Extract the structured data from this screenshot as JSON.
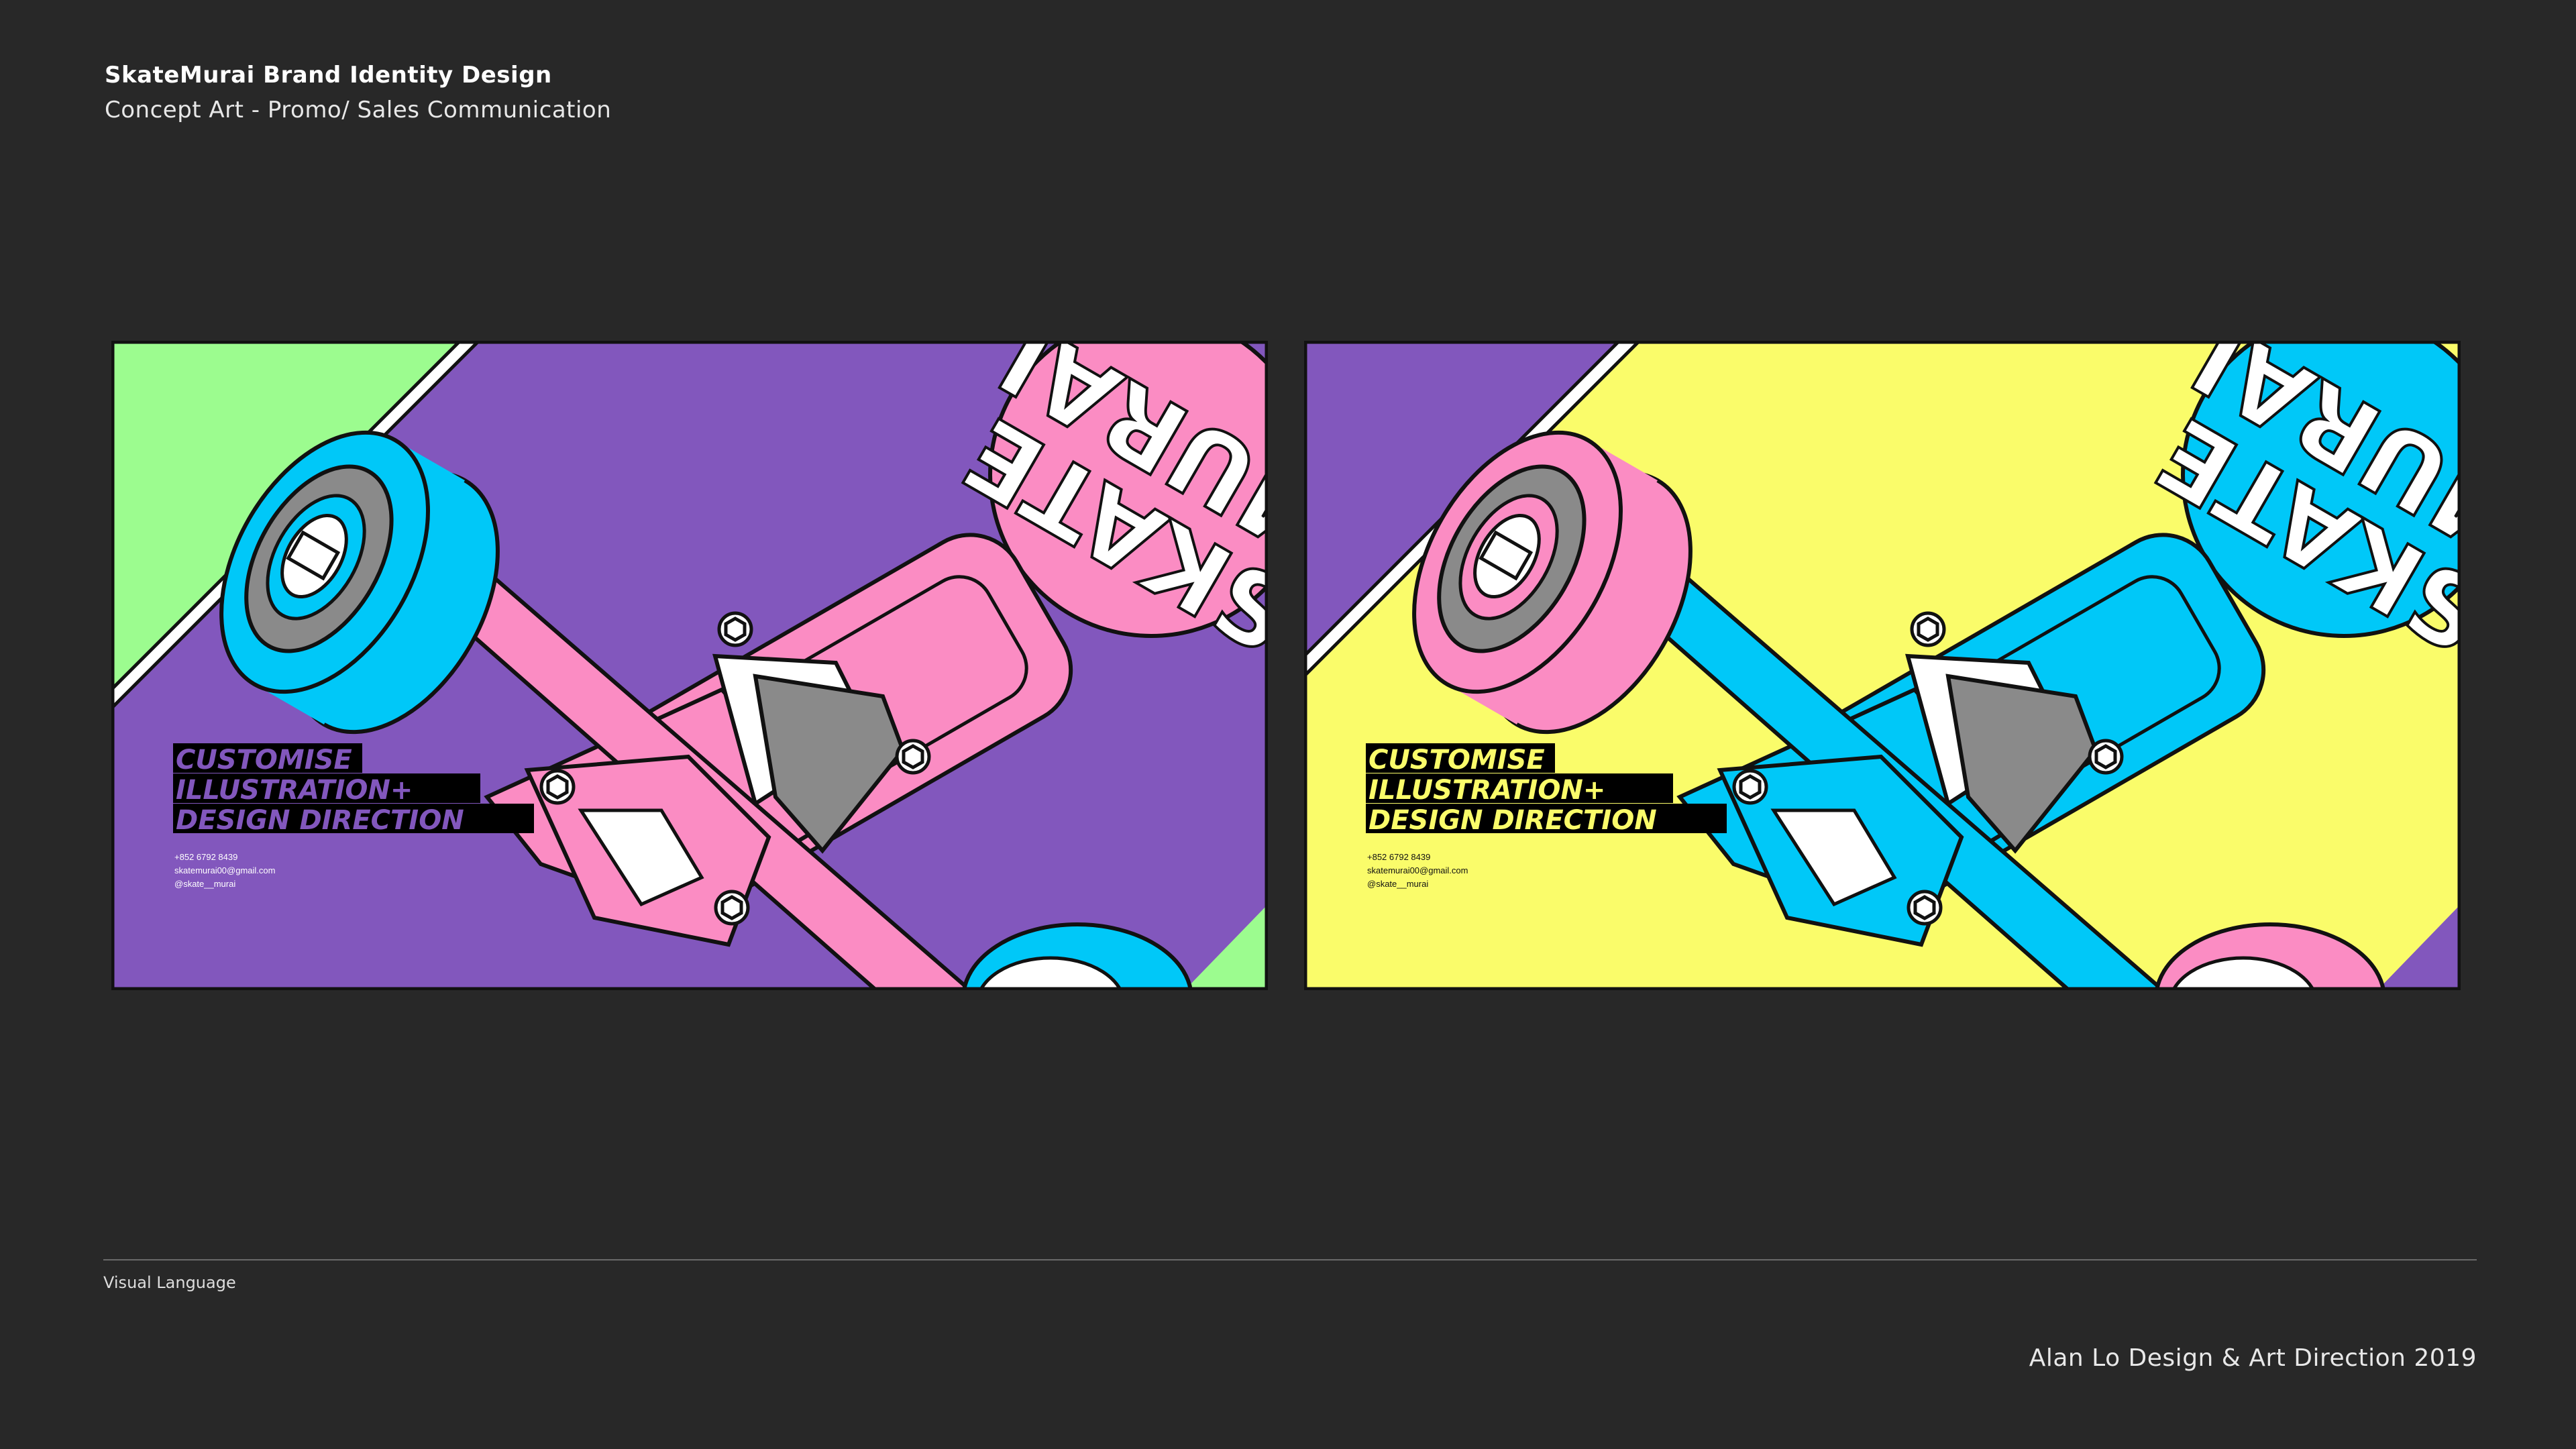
{
  "header": {
    "title": "SkateMurai Brand Identity Design",
    "subtitle": "Concept Art - Promo/ Sales Communication"
  },
  "footer": {
    "section_label": "Visual Language",
    "credit": "Alan Lo Design & Art Direction 2019"
  },
  "cards": [
    {
      "tagline": [
        "CUSTOMISE",
        "ILLUSTRATION+",
        "DESIGN DIRECTION"
      ],
      "contact": [
        "+852 6792 8439",
        "skatemurai00@gmail.com",
        "@skate__murai"
      ],
      "logo_text": [
        "SKATE",
        "MURAI"
      ],
      "colors": {
        "background": "#8257bd",
        "corner": "#9cfc8f",
        "wheel": "#00c8f8",
        "truck": "#fb8cc3",
        "logo_bg": "#fb8cc3",
        "tag_text": "#8257bd"
      }
    },
    {
      "tagline": [
        "CUSTOMISE",
        "ILLUSTRATION+",
        "DESIGN DIRECTION"
      ],
      "contact": [
        "+852 6792 8439",
        "skatemurai00@gmail.com",
        "@skate__murai"
      ],
      "logo_text": [
        "SKATE",
        "MURAI"
      ],
      "colors": {
        "background": "#fafc6a",
        "corner": "#8257bd",
        "wheel": "#fb8cc3",
        "truck": "#00c8f8",
        "logo_bg": "#00c8f8",
        "tag_text": "#fafc6a"
      }
    }
  ]
}
